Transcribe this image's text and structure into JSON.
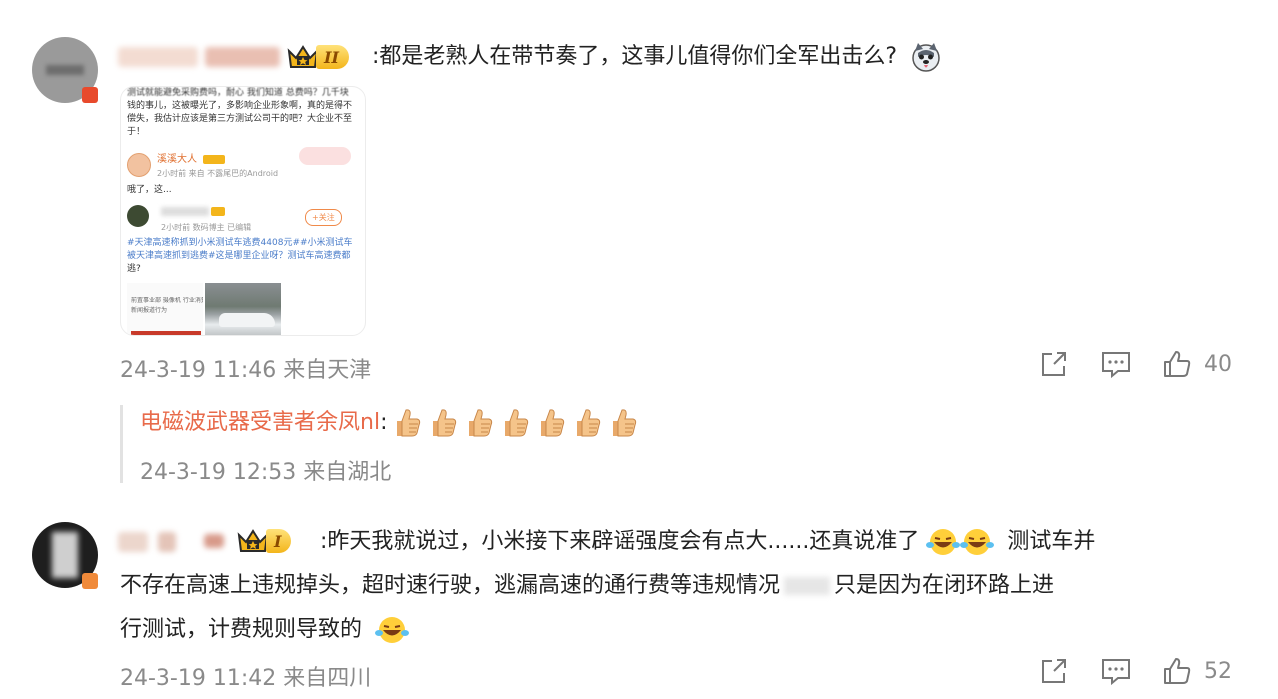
{
  "comments": [
    {
      "level": "II",
      "text": ":都是老熟人在带节奏了，这事儿值得你们全军出击么?",
      "time": "24-3-19 11:46 来自天津",
      "likes": "40",
      "image": {
        "line1": "测试就能避免采购费吗，耐心  我们知道  总费吗？几千块",
        "line2": "钱的事儿，这被曝光了，多影响企业形象啊，真的是得不",
        "line3": "偿失，我估计应该是第三方测试公司干的吧？大企业不至",
        "line4": "于！",
        "user1_name": "溪溪大人",
        "user1_meta": "2小时前  来自 不露尾巴的Android",
        "user1_text": "哦了，这...",
        "user2_meta": "2小时前  数码博主  已编辑",
        "follow_label": "+关注",
        "post_line1": "#天津高速称抓到小米测试车逃费4408元##小米测试车",
        "post_line2": "被天津高速抓到逃费#这是哪里企业呀？测试车高速费都",
        "post_line3": "逃?",
        "doc_line1": "前置事业部  摄像机  行业消费者",
        "doc_line2": "新闻报道行为"
      },
      "reply": {
        "name": "电磁波武器受害者余凤nl",
        "sep": ":",
        "emoji_count": 7,
        "time": "24-3-19 12:53 来自湖北"
      }
    },
    {
      "level": "I",
      "text_line1": ":昨天我就说过，小米接下来辟谣强度会有点大......还真说准了",
      "text_line1b": "测试车并",
      "text_line2": "不存在高速上违规掉头，超时速行驶，逃漏高速的通行费等违规情况",
      "text_line2b": "只是因为在闭环路上进",
      "text_line3": "行测试，计费规则导致的",
      "time": "24-3-19 11:42 来自四川",
      "likes": "52"
    }
  ],
  "colors": {
    "text": "#222222",
    "meta": "#8a8a8a",
    "reply_name": "#e86a4a",
    "gold": "#f3b51b"
  }
}
